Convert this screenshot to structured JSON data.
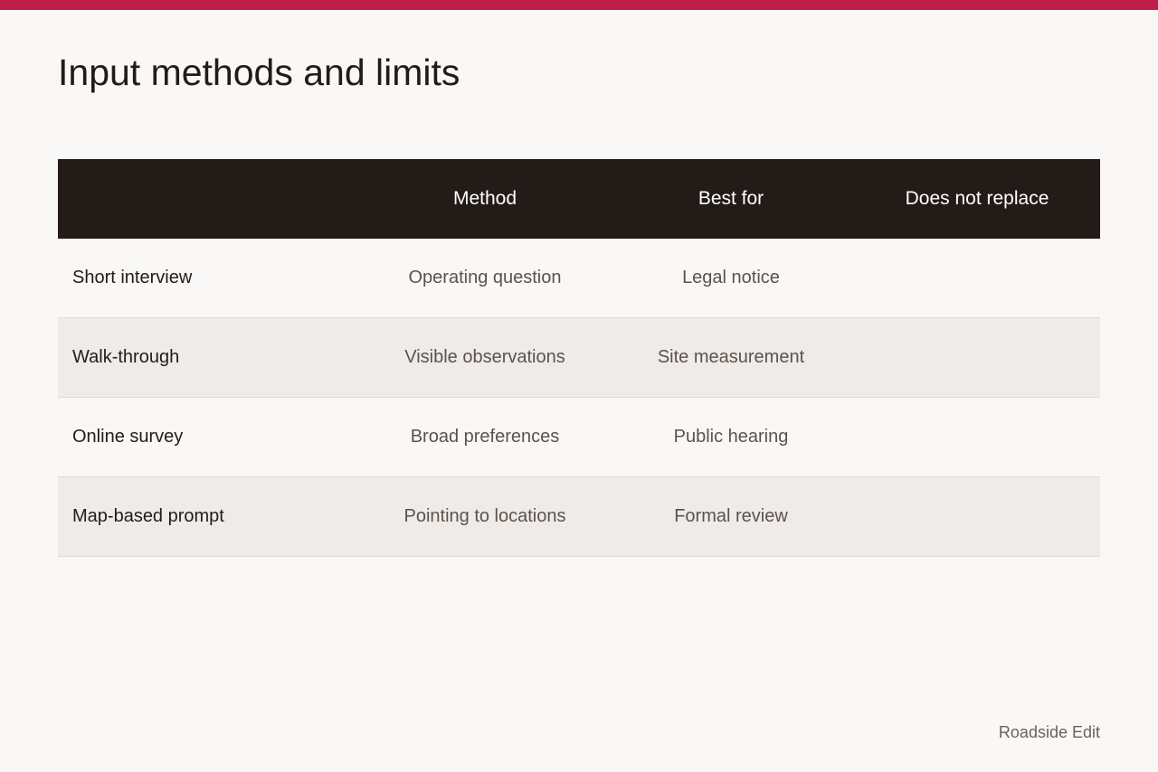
{
  "colors": {
    "accent": "#bd1e4a",
    "header_bg": "#231b17",
    "page_bg": "#f9f8f6",
    "row_alt_bg": "#efebe8"
  },
  "page": {
    "title": "Input methods and limits"
  },
  "table": {
    "headers": [
      "",
      "Method",
      "Best for",
      "Does not replace"
    ],
    "rows": [
      {
        "label": "Short interview",
        "method": "Operating question",
        "best_for": "Legal notice",
        "does_not_replace": ""
      },
      {
        "label": "Walk-through",
        "method": "Visible observations",
        "best_for": "Site measurement",
        "does_not_replace": ""
      },
      {
        "label": "Online survey",
        "method": "Broad preferences",
        "best_for": "Public hearing",
        "does_not_replace": ""
      },
      {
        "label": "Map-based prompt",
        "method": "Pointing to locations",
        "best_for": "Formal review",
        "does_not_replace": ""
      }
    ]
  },
  "footer": {
    "brand": "Roadside Edit"
  }
}
